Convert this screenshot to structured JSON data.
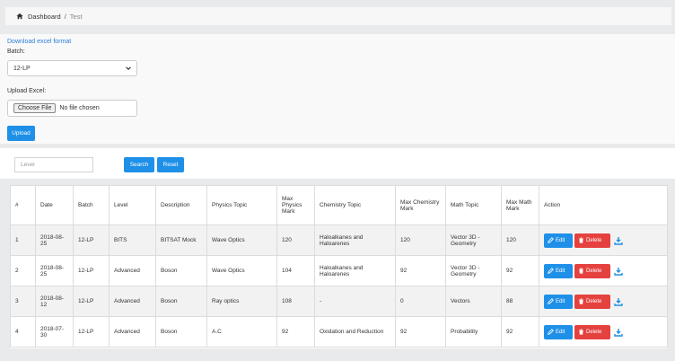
{
  "breadcrumb": {
    "home": "Dashboard",
    "separator": "/",
    "current": "Test"
  },
  "upload": {
    "download_link": "Download excel format",
    "batch_label": "Batch:",
    "batch_value": "12-LP",
    "upload_label": "Upload Excel:",
    "choose_file": "Choose File",
    "no_file": "No file chosen",
    "upload_button": "Upload"
  },
  "filter": {
    "level_placeholder": "Level",
    "search_button": "Search",
    "reset_button": "Reset"
  },
  "table": {
    "headers": [
      "#",
      "Date",
      "Batch",
      "Level",
      "Description",
      "Physics Topic",
      "Max Physics Mark",
      "Chemistry Topic",
      "Max Chemistry Mark",
      "Math Topic",
      "Max Math Mark",
      "Action"
    ],
    "rows": [
      {
        "num": "1",
        "date": "2018-08-25",
        "batch": "12-LP",
        "level": "BITS",
        "description": "BITSAT Mock",
        "physics": "Wave Optics",
        "max_physics": "120",
        "chemistry": "Haloalkanes and Haloarenes",
        "max_chemistry": "120",
        "math": "Vector 3D - Geometry",
        "max_math": "120"
      },
      {
        "num": "2",
        "date": "2018-08-25",
        "batch": "12-LP",
        "level": "Advanced",
        "description": "Boson",
        "physics": "Wave Optics",
        "max_physics": "104",
        "chemistry": "Haloalkanes and Haloarenes",
        "max_chemistry": "92",
        "math": "Vector 3D - Geometry",
        "max_math": "92"
      },
      {
        "num": "3",
        "date": "2018-08-12",
        "batch": "12-LP",
        "level": "Advanced",
        "description": "Boson",
        "physics": "Ray optics",
        "max_physics": "108",
        "chemistry": "-",
        "max_chemistry": "0",
        "math": "Vectors",
        "max_math": "88"
      },
      {
        "num": "4",
        "date": "2018-07-30",
        "batch": "12-LP",
        "level": "Advanced",
        "description": "Boson",
        "physics": "A.C",
        "max_physics": "92",
        "chemistry": "Oxidation and Reduction",
        "max_chemistry": "92",
        "math": "Probability",
        "max_math": "92"
      }
    ],
    "edit_label": "Edit",
    "delete_label": "Delete"
  },
  "colors": {
    "primary": "#1e90e8",
    "danger": "#e5413f",
    "link": "#2a7fd4"
  }
}
